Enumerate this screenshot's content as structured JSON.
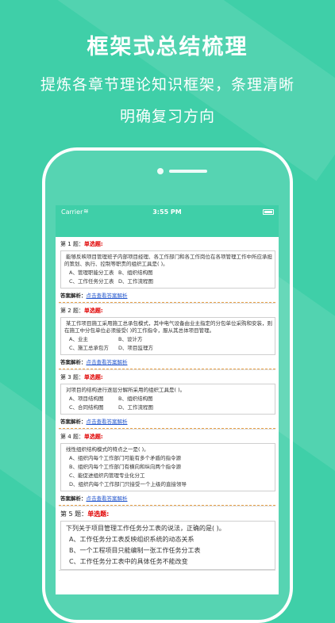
{
  "promo": {
    "headline": "框架式总结梳理",
    "sub_line1": "提炼各章节理论知识框架，条理清晰",
    "sub_line2": "明确复习方向"
  },
  "status_bar": {
    "carrier": "Carrier",
    "wifi_icon": "≋",
    "time": "3:55 PM"
  },
  "questions": [
    {
      "prefix": "第 1 题：",
      "type": "单选题:",
      "stem": "能够反映项目管理班子内部项目经理、各工作部门和各工作岗位在各项管理工作中所应承担的策划、执行、控制等职责的组织工具是(    )。",
      "opts": [
        "A、管理职能分工表",
        "B、组织结构图",
        "C、工作任务分工表",
        "D、工作流程图"
      ],
      "answer_label": "答案解析：",
      "answer_link": "点击查看答案解析"
    },
    {
      "prefix": "第 2 题：",
      "type": "单选题:",
      "stem": "某工作项目施工采用施工总承包模式，其中电气设备由业主指定的分包单位采购和安装，则在施工中分包单位必须接受(    )的工作指令，服从其总体项目管理。",
      "opts": [
        "A、业主",
        "B、设计方",
        "C、施工总承包方",
        "D、项目监理方"
      ],
      "answer_label": "答案解析：",
      "answer_link": "点击查看答案解析"
    },
    {
      "prefix": "第 3 题：",
      "type": "单选题:",
      "stem": "对项目的结构进行逐层分解所采用的组织工具是(    )。",
      "opts": [
        "A、项目结构图",
        "B、组织结构图",
        "C、合同结构图",
        "D、工作流程图"
      ],
      "answer_label": "答案解析：",
      "answer_link": "点击查看答案解析"
    },
    {
      "prefix": "第 4 题：",
      "type": "单选题:",
      "stem": "线性组织结构模式的特点之一是(    )。",
      "opts": [
        "A、组织内每个工作部门可能有多个矛盾的指令源",
        "B、组织内每个工作部门有横向和纵向两个指令源",
        "C、能促进组织内管理专业化分工",
        "D、组织内每个工作部门只接受一个上级的直接领导"
      ],
      "answer_label": "答案解析：",
      "answer_link": "点击查看答案解析"
    },
    {
      "prefix": "第 5 题：",
      "type": "单选题:",
      "stem": "下列关于项目管理工作任务分工表的说法，正确的是(    )。",
      "opts": [
        "A、工作任务分工表反映组织系统的动态关系",
        "B、一个工程项目只能编制一张工作任务分工表",
        "C、工作任务分工表中的具体任务不能改变"
      ]
    }
  ]
}
